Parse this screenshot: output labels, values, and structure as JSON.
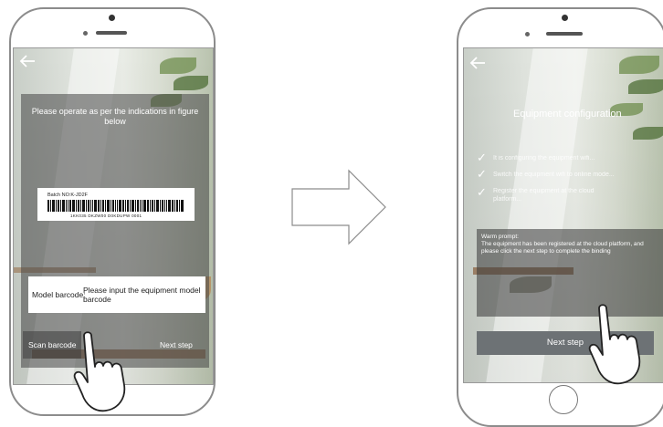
{
  "left_screen": {
    "back_icon": "arrow-left-icon",
    "instruction": "Please operate as per the indications in figure below",
    "barcode": {
      "batch_label": "Batch NO:K-JD2F",
      "number": "1KK035 DKZW00 D0KDUPW 0001"
    },
    "model_barcode_label": "Model barcode:",
    "model_barcode_placeholder": "Please input the equipment model barcode",
    "scan_button": "Scan barcode",
    "next_button": "Next step"
  },
  "right_screen": {
    "back_icon": "arrow-left-icon",
    "title": "Equipment configuration",
    "steps": [
      "It is configuring the equipment wifi...",
      "Switch the equipment wifi to online mode...",
      "Register the equipment at the cloud platform..."
    ],
    "prompt_title": "Warm prompt:",
    "prompt_body": "The equipment has been registered at the cloud platform, and please click the next step to complete the binding",
    "next_button": "Next step"
  },
  "colors": {
    "frame": "#8c8c8c",
    "panel": "#464646",
    "next_button_bg": "#6d7275"
  },
  "icons": [
    "arrow-left-icon",
    "check-icon",
    "right-arrow-outline-icon",
    "pointing-hand-icon"
  ]
}
